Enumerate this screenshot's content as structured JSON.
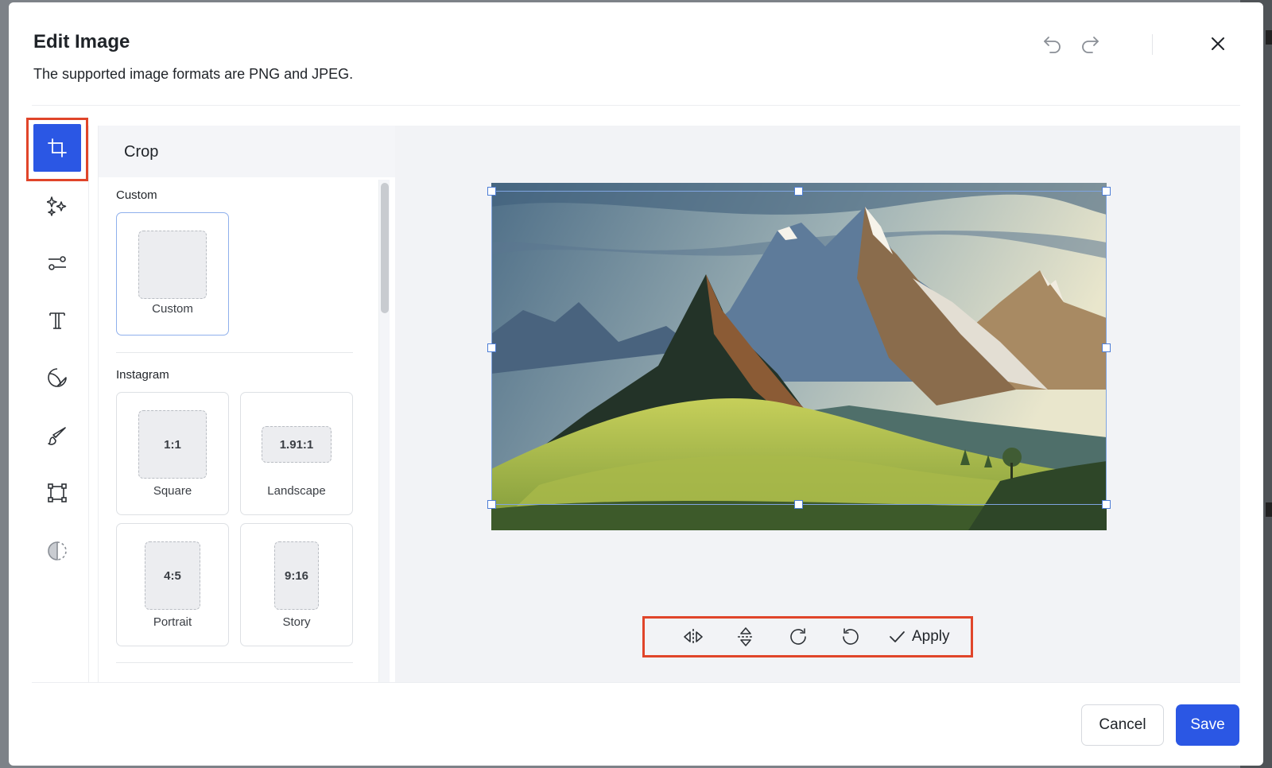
{
  "dialog": {
    "title": "Edit Image",
    "subtitle": "The supported image formats are PNG and JPEG."
  },
  "header_icons": [
    "undo-icon",
    "redo-icon",
    "close-icon"
  ],
  "tools": [
    {
      "name": "crop",
      "icon": "crop-icon",
      "active": true
    },
    {
      "name": "magic",
      "icon": "sparkles-icon",
      "active": false
    },
    {
      "name": "adjust",
      "icon": "sliders-icon",
      "active": false
    },
    {
      "name": "text",
      "icon": "text-icon",
      "active": false
    },
    {
      "name": "sticker",
      "icon": "sticker-icon",
      "active": false
    },
    {
      "name": "draw",
      "icon": "brush-icon",
      "active": false
    },
    {
      "name": "frame",
      "icon": "frame-icon",
      "active": false
    },
    {
      "name": "filter",
      "icon": "contrast-icon",
      "active": false
    }
  ],
  "panel": {
    "title": "Crop",
    "custom_section": {
      "label": "Custom",
      "option": {
        "label": "Custom",
        "thumb": ""
      }
    },
    "instagram_section": {
      "label": "Instagram",
      "options": [
        {
          "ratio": "1:1",
          "label": "Square"
        },
        {
          "ratio": "1.91:1",
          "label": "Landscape"
        },
        {
          "ratio": "4:5",
          "label": "Portrait"
        },
        {
          "ratio": "9:16",
          "label": "Story"
        }
      ]
    }
  },
  "actions": {
    "icons": [
      "flip-horizontal-icon",
      "flip-vertical-icon",
      "rotate-clockwise-icon",
      "rotate-counterclockwise-icon"
    ],
    "apply_label": "Apply"
  },
  "footer": {
    "cancel_label": "Cancel",
    "save_label": "Save"
  },
  "colors": {
    "accent": "#2b57e4",
    "highlight": "#e0452a"
  }
}
